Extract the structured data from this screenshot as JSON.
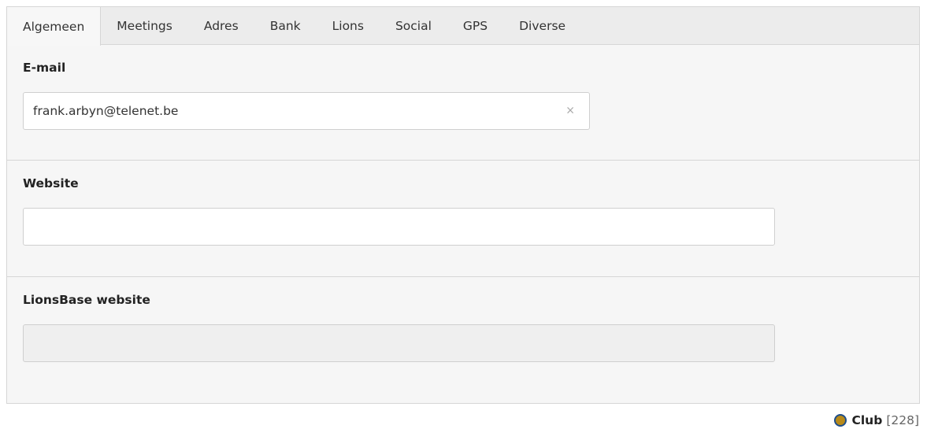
{
  "tabs": [
    {
      "label": "Algemeen"
    },
    {
      "label": "Meetings"
    },
    {
      "label": "Adres"
    },
    {
      "label": "Bank"
    },
    {
      "label": "Lions"
    },
    {
      "label": "Social"
    },
    {
      "label": "GPS"
    },
    {
      "label": "Diverse"
    }
  ],
  "active_tab": "Algemeen",
  "email": {
    "label": "E-mail",
    "value": "frank.arbyn@telenet.be",
    "clear_icon": "×"
  },
  "website": {
    "label": "Website",
    "value": ""
  },
  "lionsbase": {
    "label": "LionsBase website",
    "value": ""
  },
  "footer": {
    "icon": "lions-logo-icon",
    "record_type": "Club",
    "record_id": "[228]"
  }
}
